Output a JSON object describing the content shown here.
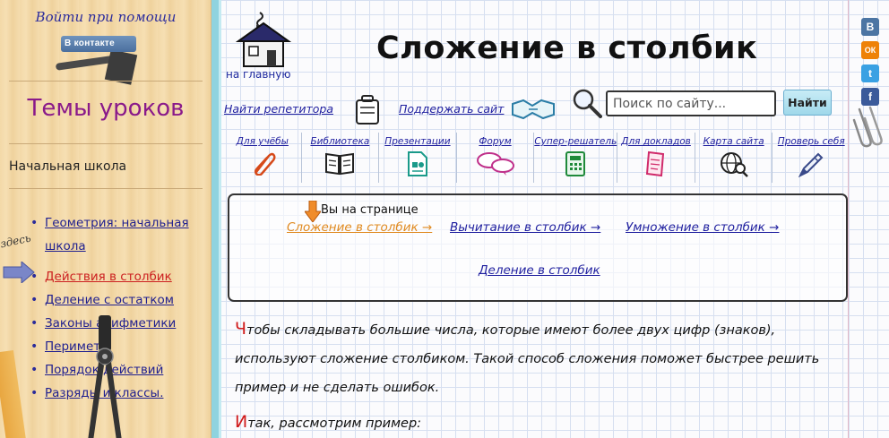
{
  "sidebar": {
    "login_title": "Войти при помощи",
    "vk_label": "контакте",
    "vk_letter": "В",
    "topics_title": "Темы уроков",
    "section_label": "Начальная школа",
    "here_label": "здесь",
    "topics": [
      "Геометрия: начальная школа",
      "Действия в столбик",
      "Деление с остатком",
      "Законы арифметики",
      "Периметр",
      "Порядок действий",
      "Разряды и классы."
    ]
  },
  "header": {
    "home_label": "на главную",
    "page_title": "Сложение в столбик",
    "tutor_link": "Найти репетитора",
    "support_link": "Поддержать сайт",
    "search_placeholder": "Поиск по сайту...",
    "search_button": "Найти"
  },
  "nav": [
    {
      "label": "Для учёбы",
      "icon": "paperclip-icon"
    },
    {
      "label": "Библиотека",
      "icon": "book-icon"
    },
    {
      "label": "Презентации",
      "icon": "presentation-icon"
    },
    {
      "label": "Форум",
      "icon": "chat-icon"
    },
    {
      "label": "Супер-решатель",
      "icon": "calculator-icon"
    },
    {
      "label": "Для докладов",
      "icon": "document-icon"
    },
    {
      "label": "Карта сайта",
      "icon": "globe-search-icon"
    },
    {
      "label": "Проверь себя",
      "icon": "pencil-icon"
    }
  ],
  "breadcrumb": {
    "label": "Вы на странице",
    "current": "Сложение в столбик →",
    "links": [
      "Вычитание в столбик →",
      "Умножение в столбик →",
      "Деление в столбик"
    ]
  },
  "content": {
    "p1_cap": "Ч",
    "p1_rest": "тобы складывать большие числа, которые имеют более двух цифр (знаков), используют сложение столбиком. Такой способ сложения поможет быстрее решить пример и не сделать ошибок.",
    "p2_cap": "И",
    "p2_rest": "так, рассмотрим пример:"
  },
  "social": {
    "vk": "В",
    "ok": "ОК",
    "tw": "t",
    "fb": "f"
  },
  "colors": {
    "link": "#1f1f9f",
    "active_topic": "#cc2020",
    "current_page": "#e08a20",
    "topics_title": "#8a1a8a",
    "binding": "#8fd3df"
  }
}
